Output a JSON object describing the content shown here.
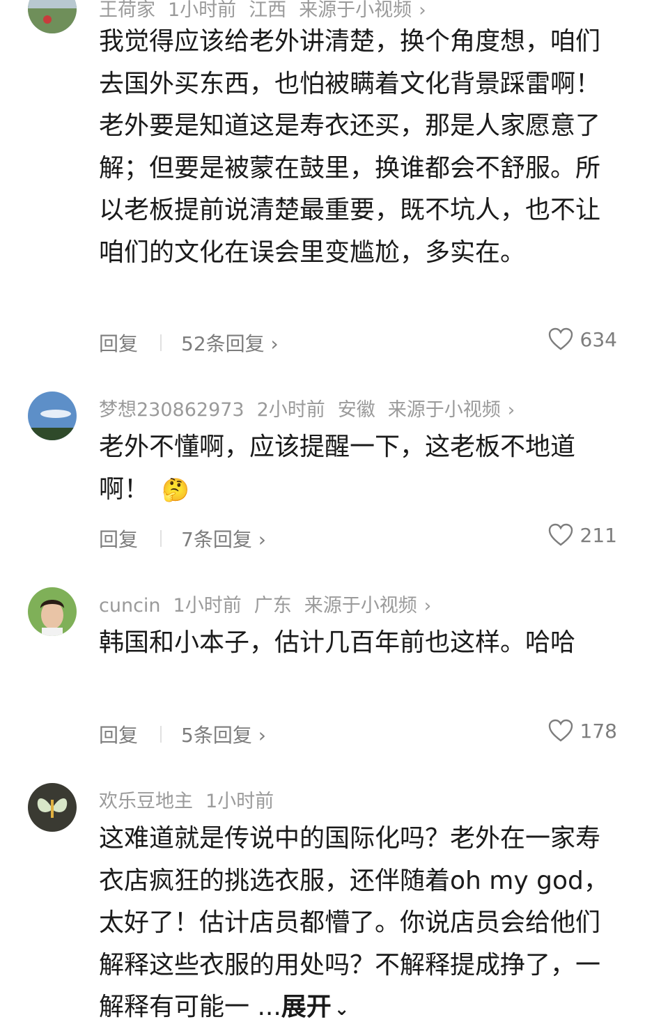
{
  "comments": [
    {
      "meta": {
        "user": "王荷家",
        "time": "1小时前",
        "location": "江西",
        "source": "来源于小视频"
      },
      "text": "我觉得应该给老外讲清楚，换个角度想，咱们去国外买东西，也怕被瞒着文化背景踩雷啊！老外要是知道这是寿衣还买，那是人家愿意了解；但要是被蒙在鼓里，换谁都会不舒服。所以老板提前说清楚最重要，既不坑人，也不让咱们的文化在误会里变尴尬，多实在。",
      "reply_label": "回复",
      "replies_label": "52条回复",
      "likes": "634"
    },
    {
      "meta": {
        "user": "梦想230862973",
        "time": "2小时前",
        "location": "安徽",
        "source": "来源于小视频"
      },
      "text": "老外不懂啊，应该提醒一下，这老板不地道啊！",
      "emoji": "🤔",
      "reply_label": "回复",
      "replies_label": "7条回复",
      "likes": "211"
    },
    {
      "meta": {
        "user": "cuncin",
        "time": "1小时前",
        "location": "广东",
        "source": "来源于小视频"
      },
      "text": "韩国和小本子，估计几百年前也这样。哈哈",
      "reply_label": "回复",
      "replies_label": "5条回复",
      "likes": "178"
    },
    {
      "meta": {
        "user": "欢乐豆地主",
        "time": "1小时前"
      },
      "text": "这难道就是传说中的国际化吗？老外在一家寿衣店疯狂的挑选衣服，还伴随着oh my god，太好了！估计店员都懵了。你说店员会给他们解释这些衣服的用处吗？不解释提成挣了，一解释有可能一 ...",
      "expand_label": "展开"
    }
  ],
  "colors": {
    "text": "#1a1a1a",
    "meta": "#9a9a9a",
    "action": "#7d7d7d"
  },
  "icons": {
    "like": "heart-outline-icon",
    "chevron": "chevron-right-icon",
    "expand": "chevron-down-icon"
  }
}
